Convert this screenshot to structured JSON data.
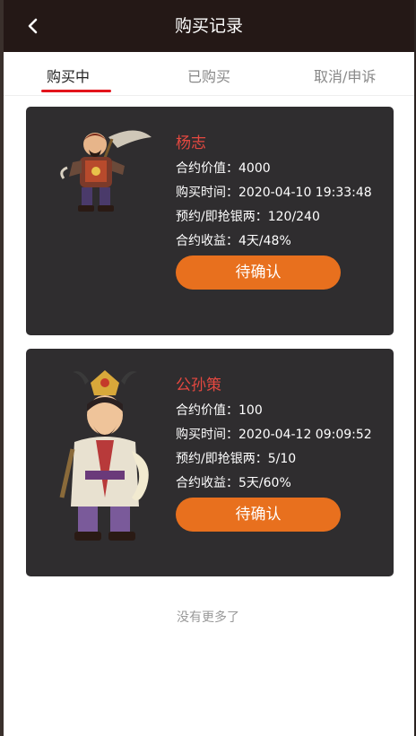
{
  "header": {
    "title": "购买记录",
    "back_icon": "chevron-left-icon"
  },
  "tabs": [
    {
      "label": "购买中",
      "active": true
    },
    {
      "label": "已购买",
      "active": false
    },
    {
      "label": "取消/申诉",
      "active": false
    }
  ],
  "orders": [
    {
      "name": "杨志",
      "contract_value": "合约价值：4000",
      "purchase_time": "购买时间：2020-04-10 19:33:48",
      "reserve": "预约/即抢银两：120/240",
      "profit": "合约收益：4天/48%",
      "status_button": "待确认",
      "avatar": "warrior-avatar"
    },
    {
      "name": "公孙策",
      "contract_value": "合约价值：100",
      "purchase_time": "购买时间：2020-04-12 09:09:52",
      "reserve": "预约/即抢银两：5/10",
      "profit": "合约收益：5天/60%",
      "status_button": "待确认",
      "avatar": "strategist-avatar"
    }
  ],
  "footer": {
    "text": "没有更多了"
  },
  "colors": {
    "accent": "#e8701e",
    "name": "#e44840",
    "card": "#2f2d2f",
    "tab_underline": "#e3141c"
  }
}
